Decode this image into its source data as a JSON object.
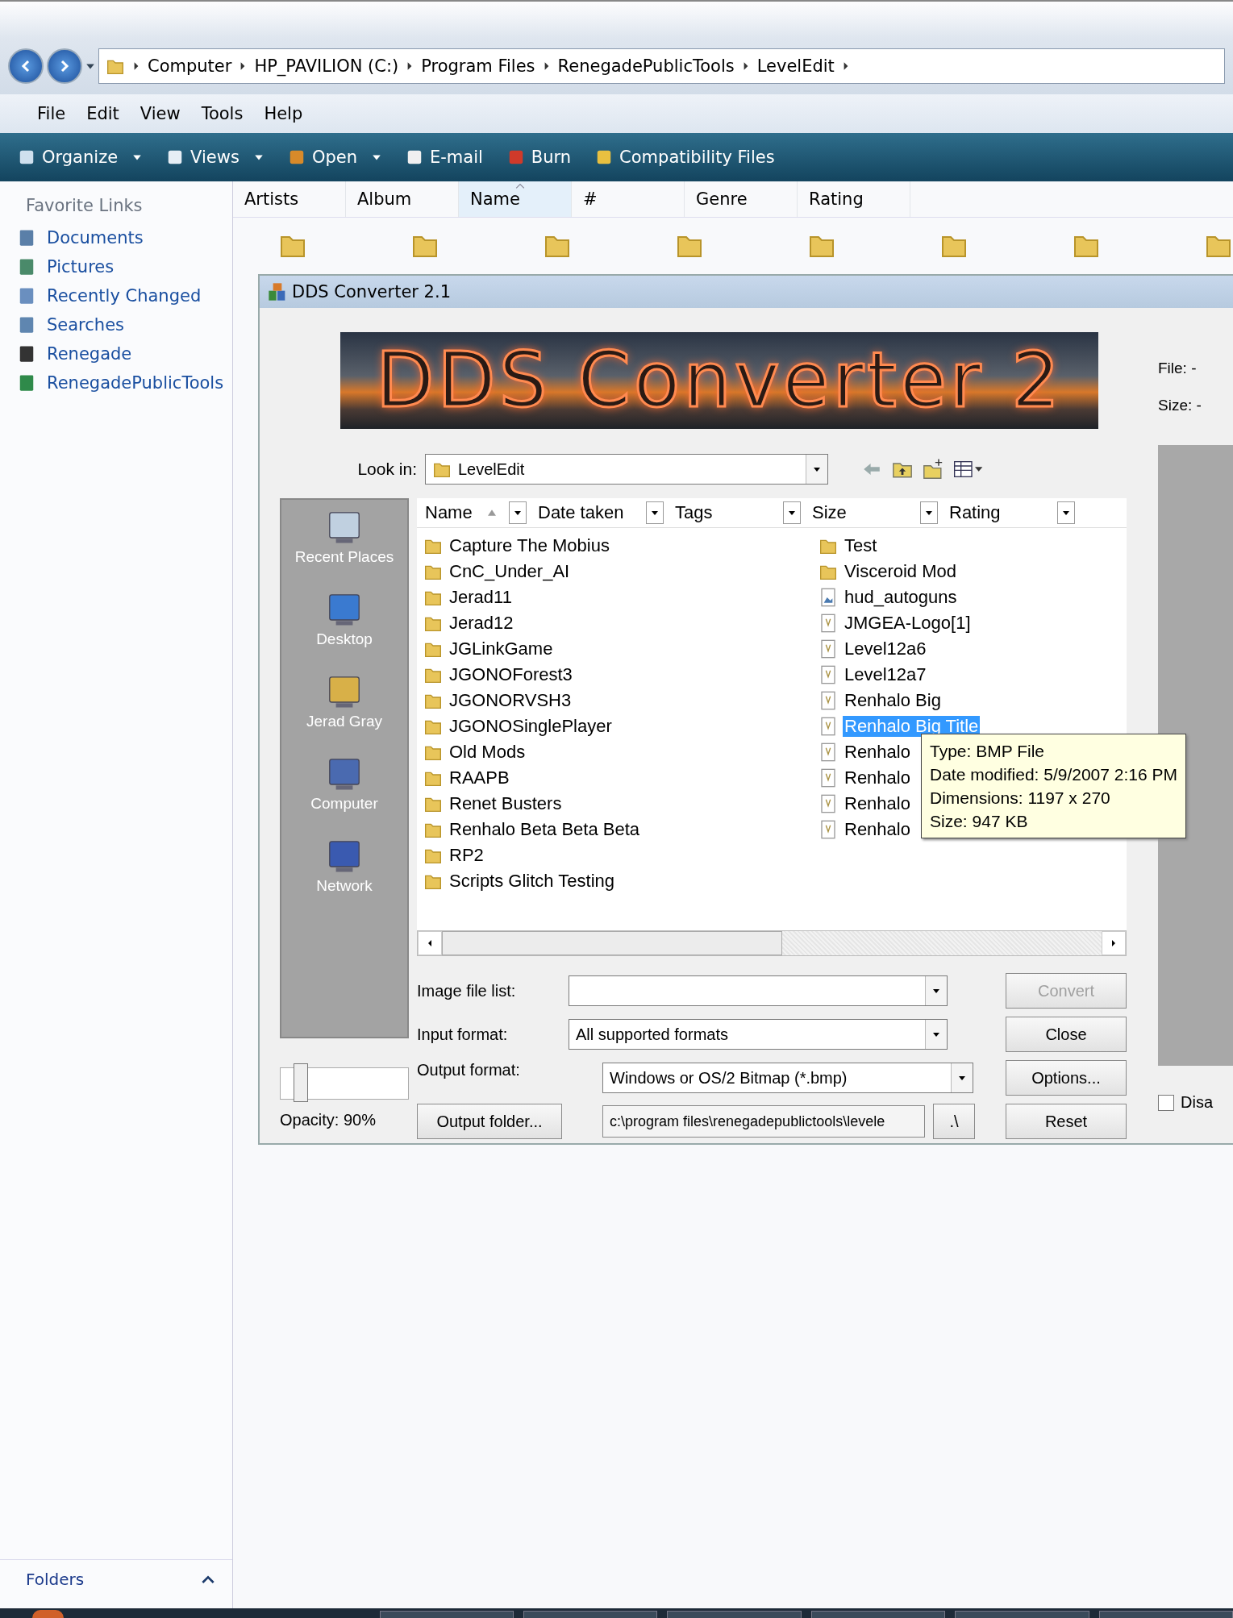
{
  "explorer": {
    "breadcrumbs": [
      "Computer",
      "HP_PAVILION (C:)",
      "Program Files",
      "RenegadePublicTools",
      "LevelEdit"
    ],
    "menu": [
      "File",
      "Edit",
      "View",
      "Tools",
      "Help"
    ],
    "toolbar": [
      {
        "label": "Organize",
        "kind": "organize",
        "dropdown": true
      },
      {
        "label": "Views",
        "kind": "views",
        "dropdown": true
      },
      {
        "label": "Open",
        "kind": "open",
        "dropdown": true
      },
      {
        "label": "E-mail",
        "kind": "email",
        "dropdown": false
      },
      {
        "label": "Burn",
        "kind": "burn",
        "dropdown": false
      },
      {
        "label": "Compatibility Files",
        "kind": "compat",
        "dropdown": false
      }
    ],
    "favorites_title": "Favorite Links",
    "favorites": [
      {
        "label": "Documents",
        "kind": "documents"
      },
      {
        "label": "Pictures",
        "kind": "pictures"
      },
      {
        "label": "Recently Changed",
        "kind": "recent"
      },
      {
        "label": "Searches",
        "kind": "searches"
      },
      {
        "label": "Renegade",
        "kind": "renegade"
      },
      {
        "label": "RenegadePublicTools",
        "kind": "tools"
      }
    ],
    "columns": [
      {
        "label": "Artists",
        "sorted": false
      },
      {
        "label": "Album",
        "sorted": false
      },
      {
        "label": "Name",
        "sorted": true
      },
      {
        "label": "#",
        "sorted": false
      },
      {
        "label": "Genre",
        "sorted": false
      },
      {
        "label": "Rating",
        "sorted": false
      }
    ],
    "folders_label": "Folders"
  },
  "dialog": {
    "title": "DDS Converter 2.1",
    "banner_text": "DDS Converter 2",
    "info": [
      "File: -",
      "Size: -"
    ],
    "look_in": {
      "label": "Look in:",
      "value": "LevelEdit"
    },
    "list_columns": [
      "Name",
      "Date taken",
      "Tags",
      "Size",
      "Rating"
    ],
    "places": [
      {
        "label": "Recent Places",
        "kind": "recent"
      },
      {
        "label": "Desktop",
        "kind": "desktop"
      },
      {
        "label": "Jerad Gray",
        "kind": "user"
      },
      {
        "label": "Computer",
        "kind": "computer"
      },
      {
        "label": "Network",
        "kind": "network"
      }
    ],
    "files": [
      {
        "name": "Capture The Mobius",
        "kind": "folder",
        "selected": false
      },
      {
        "name": "CnC_Under_AI",
        "kind": "folder",
        "selected": false
      },
      {
        "name": "Jerad11",
        "kind": "folder",
        "selected": false
      },
      {
        "name": "Jerad12",
        "kind": "folder",
        "selected": false
      },
      {
        "name": "JGLinkGame",
        "kind": "folder",
        "selected": false
      },
      {
        "name": "JGONOForest3",
        "kind": "folder",
        "selected": false
      },
      {
        "name": "JGONORVSH3",
        "kind": "folder",
        "selected": false
      },
      {
        "name": "JGONOSinglePlayer",
        "kind": "folder",
        "selected": false
      },
      {
        "name": "Old Mods",
        "kind": "folder",
        "selected": false
      },
      {
        "name": "RAAPB",
        "kind": "folder",
        "selected": false
      },
      {
        "name": "Renet Busters",
        "kind": "folder",
        "selected": false
      },
      {
        "name": "Renhalo Beta Beta Beta",
        "kind": "folder",
        "selected": false
      },
      {
        "name": "RP2",
        "kind": "folder",
        "selected": false
      },
      {
        "name": "Scripts Glitch Testing",
        "kind": "folder",
        "selected": false
      },
      {
        "name": "Test",
        "kind": "folder",
        "selected": false
      },
      {
        "name": "Visceroid Mod",
        "kind": "folder",
        "selected": false
      },
      {
        "name": "hud_autoguns",
        "kind": "image",
        "selected": false
      },
      {
        "name": "JMGEA-Logo[1]",
        "kind": "bitmap",
        "selected": false
      },
      {
        "name": "Level12a6",
        "kind": "bitmap",
        "selected": false
      },
      {
        "name": "Level12a7",
        "kind": "bitmap",
        "selected": false
      },
      {
        "name": "Renhalo Big",
        "kind": "bitmap",
        "selected": false
      },
      {
        "name": "Renhalo Big Title",
        "kind": "bitmap",
        "selected": true
      },
      {
        "name": "Renhalo",
        "kind": "bitmap",
        "selected": false
      },
      {
        "name": "Renhalo",
        "kind": "bitmap",
        "selected": false
      },
      {
        "name": "Renhalo",
        "kind": "bitmap",
        "selected": false
      },
      {
        "name": "Renhalo",
        "kind": "bitmap",
        "selected": false
      }
    ],
    "tooltip": [
      "Type: BMP File",
      "Date modified: 5/9/2007 2:16 PM",
      "Dimensions: 1197 x 270",
      "Size: 947 KB"
    ],
    "image_file_list": {
      "label": "Image file list:"
    },
    "input_format": {
      "label": "Input format:",
      "value": "All supported formats"
    },
    "output_format": {
      "label": "Output format:",
      "value": "Windows or OS/2 Bitmap (*.bmp)"
    },
    "output_folder": {
      "button": "Output folder...",
      "value": "c:\\program files\\renegadepublictools\\levele",
      "browse": ".\\"
    },
    "buttons": [
      {
        "label": "Convert",
        "disabled": true
      },
      {
        "label": "Close",
        "disabled": false
      },
      {
        "label": "Options...",
        "disabled": false
      },
      {
        "label": "Reset",
        "disabled": false
      }
    ],
    "opacity": {
      "label": "Opacity: 90%",
      "level": 0.1
    },
    "checkbox": {
      "label": "Disa",
      "checked": false
    }
  }
}
